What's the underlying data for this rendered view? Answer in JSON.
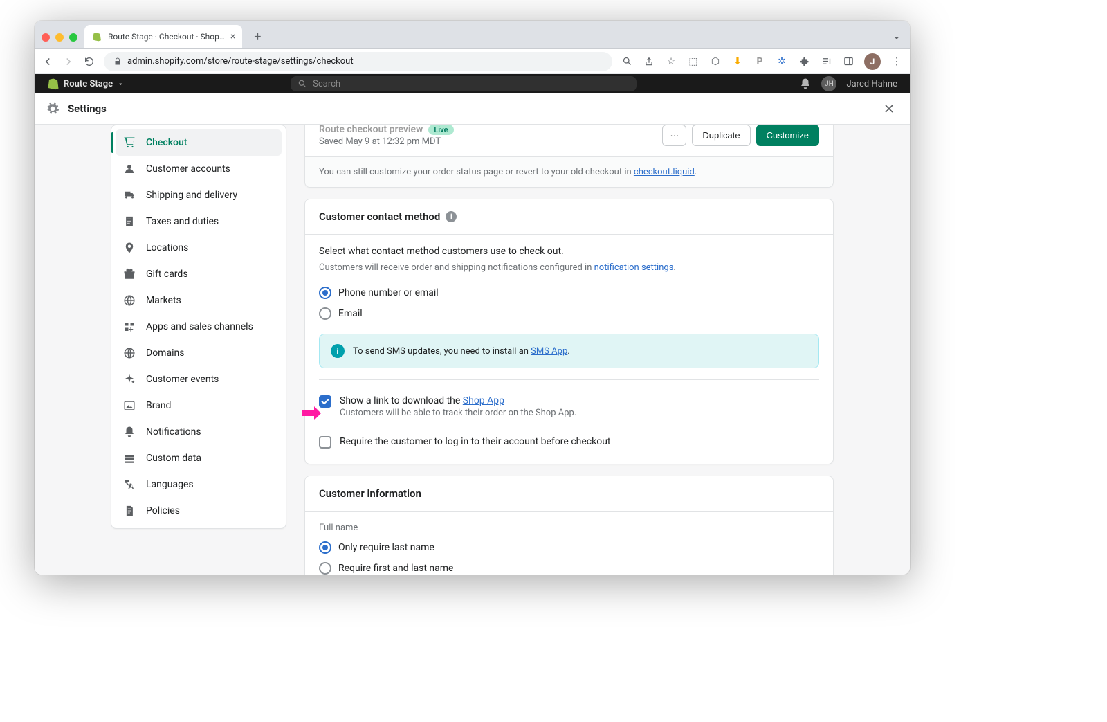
{
  "browser": {
    "tab_title": "Route Stage · Checkout · Shop…",
    "url": "admin.shopify.com/store/route-stage/settings/checkout",
    "avatar_initial": "J"
  },
  "shopify_bar": {
    "store_name": "Route Stage",
    "search_placeholder": "Search",
    "user_name": "Jared Hahne",
    "user_initials": "JH"
  },
  "settings_header": {
    "title": "Settings"
  },
  "sidebar": {
    "items": [
      {
        "label": "Checkout",
        "active": true
      },
      {
        "label": "Customer accounts"
      },
      {
        "label": "Shipping and delivery"
      },
      {
        "label": "Taxes and duties"
      },
      {
        "label": "Locations"
      },
      {
        "label": "Gift cards"
      },
      {
        "label": "Markets"
      },
      {
        "label": "Apps and sales channels"
      },
      {
        "label": "Domains"
      },
      {
        "label": "Customer events"
      },
      {
        "label": "Brand"
      },
      {
        "label": "Notifications"
      },
      {
        "label": "Custom data"
      },
      {
        "label": "Languages"
      },
      {
        "label": "Policies"
      }
    ]
  },
  "preview_card": {
    "title": "Route checkout preview",
    "badge": "Live",
    "saved": "Saved May 9 at 12:32 pm MDT",
    "more_label": "···",
    "duplicate_label": "Duplicate",
    "customize_label": "Customize",
    "footer_prefix": "You can still customize your order status page or revert to your old checkout in ",
    "footer_link": "checkout.liquid",
    "footer_suffix": "."
  },
  "contact_card": {
    "title": "Customer contact method",
    "intro": "Select what contact method customers use to check out.",
    "note_prefix": "Customers will receive order and shipping notifications configured in ",
    "note_link": "notification settings",
    "note_suffix": ".",
    "option_phone_email": "Phone number or email",
    "option_email": "Email",
    "banner_prefix": "To send SMS updates, you need to install an ",
    "banner_link": "SMS App",
    "banner_suffix": ".",
    "shop_app_prefix": "Show a link to download the ",
    "shop_app_link": "Shop App",
    "shop_app_sub": "Customers will be able to track their order on the Shop App.",
    "require_login": "Require the customer to log in to their account before checkout"
  },
  "info_card": {
    "title": "Customer information",
    "fullname_label": "Full name",
    "option_last_only": "Only require last name",
    "option_first_last": "Require first and last name"
  }
}
